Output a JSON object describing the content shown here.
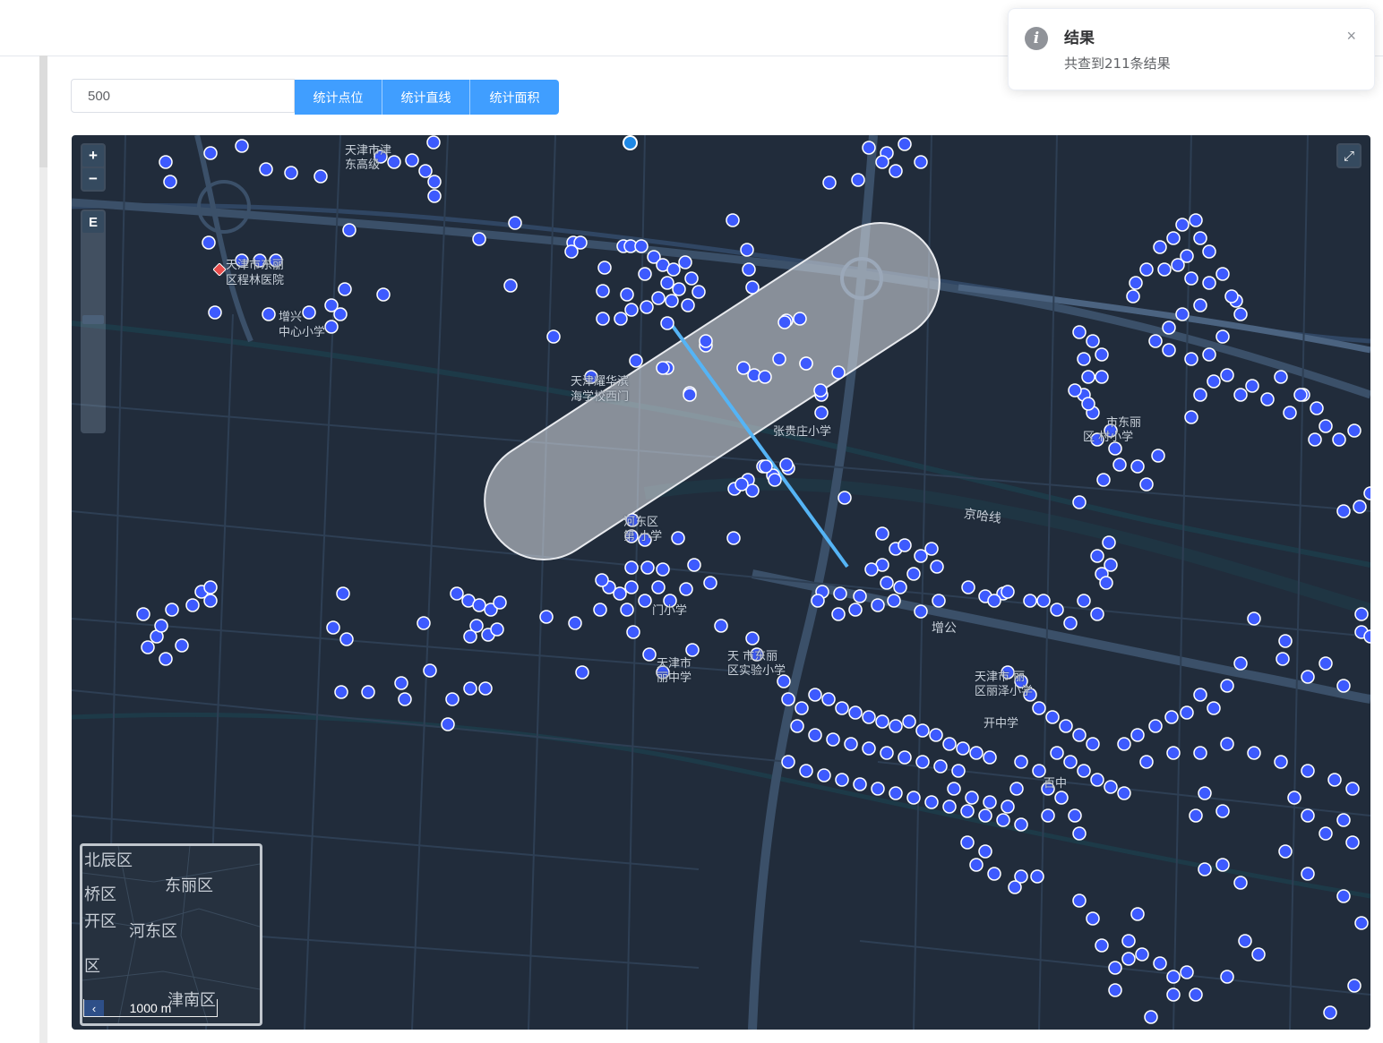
{
  "search": {
    "value": "500"
  },
  "buttons": {
    "stat_points": "统计点位",
    "stat_line": "统计直线",
    "stat_area": "统计面积"
  },
  "notification": {
    "title": "结果",
    "message": "共查到211条结果",
    "icon": "info-icon",
    "close": "×"
  },
  "map": {
    "zoom_in": "+",
    "zoom_out": "−",
    "layer_toggle": "E",
    "fullscreen": "⤢",
    "scale": "1000 m",
    "scale_arrow": "‹",
    "labels": [
      "天津市津",
      "东高级",
      "天津市东丽",
      "区程林医院",
      "增兴",
      "中心小学",
      "天津耀华滨",
      "海学校西门",
      "张贵庄小学",
      "市东丽",
      "区 村小学",
      "京哈线",
      "河东区",
      "第 小学",
      "门小学",
      "天津市",
      "丽中学",
      "天 市东丽",
      "区实验小学",
      "增公",
      "天津市 丽",
      "区丽泽小学",
      "开中学",
      "百中"
    ],
    "overview_labels": [
      "北辰区",
      "东丽区",
      "桥区",
      "开区",
      "河东区",
      "区",
      "津南区"
    ],
    "colors": {
      "background": "#212c3b",
      "marker": "#3d5afe",
      "buffer": "#d6d9df",
      "line": "#55b4f5"
    }
  }
}
